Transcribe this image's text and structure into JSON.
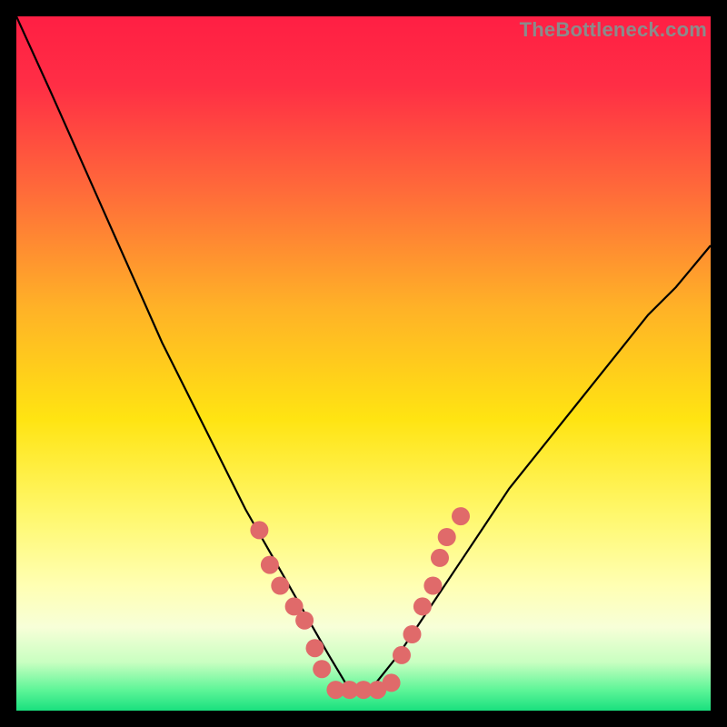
{
  "watermark": "TheBottleneck.com",
  "chart_data": {
    "type": "line",
    "title": "",
    "xlabel": "",
    "ylabel": "",
    "xlim": [
      0,
      100
    ],
    "ylim": [
      0,
      100
    ],
    "background_gradient": {
      "stops": [
        {
          "offset": 0.0,
          "color": "#ff1f44"
        },
        {
          "offset": 0.1,
          "color": "#ff2e45"
        },
        {
          "offset": 0.25,
          "color": "#ff6a3a"
        },
        {
          "offset": 0.42,
          "color": "#ffb227"
        },
        {
          "offset": 0.58,
          "color": "#ffe412"
        },
        {
          "offset": 0.72,
          "color": "#fff86e"
        },
        {
          "offset": 0.82,
          "color": "#ffffb3"
        },
        {
          "offset": 0.88,
          "color": "#f7ffd8"
        },
        {
          "offset": 0.93,
          "color": "#c9ffc1"
        },
        {
          "offset": 0.97,
          "color": "#5ef598"
        },
        {
          "offset": 1.0,
          "color": "#19e07e"
        }
      ]
    },
    "series": [
      {
        "name": "bottleneck-curve",
        "color": "#000000",
        "x": [
          0,
          5,
          9,
          13,
          17,
          21,
          25,
          29,
          33,
          37,
          41,
          45,
          48,
          51,
          55,
          59,
          63,
          67,
          71,
          75,
          79,
          83,
          87,
          91,
          95,
          100
        ],
        "y": [
          100,
          89,
          80,
          71,
          62,
          53,
          45,
          37,
          29,
          22,
          15,
          8,
          3,
          3,
          8,
          14,
          20,
          26,
          32,
          37,
          42,
          47,
          52,
          57,
          61,
          67
        ]
      }
    ],
    "markers": {
      "name": "highlight-points",
      "color": "#e06a6a",
      "radius": 10,
      "points": [
        {
          "x": 35.0,
          "y": 26
        },
        {
          "x": 36.5,
          "y": 21
        },
        {
          "x": 38.0,
          "y": 18
        },
        {
          "x": 40.0,
          "y": 15
        },
        {
          "x": 41.5,
          "y": 13
        },
        {
          "x": 43.0,
          "y": 9
        },
        {
          "x": 44.0,
          "y": 6
        },
        {
          "x": 46.0,
          "y": 3
        },
        {
          "x": 48.0,
          "y": 3
        },
        {
          "x": 50.0,
          "y": 3
        },
        {
          "x": 52.0,
          "y": 3
        },
        {
          "x": 54.0,
          "y": 4
        },
        {
          "x": 55.5,
          "y": 8
        },
        {
          "x": 57.0,
          "y": 11
        },
        {
          "x": 58.5,
          "y": 15
        },
        {
          "x": 60.0,
          "y": 18
        },
        {
          "x": 61.0,
          "y": 22
        },
        {
          "x": 62.0,
          "y": 25
        },
        {
          "x": 64.0,
          "y": 28
        }
      ]
    }
  }
}
